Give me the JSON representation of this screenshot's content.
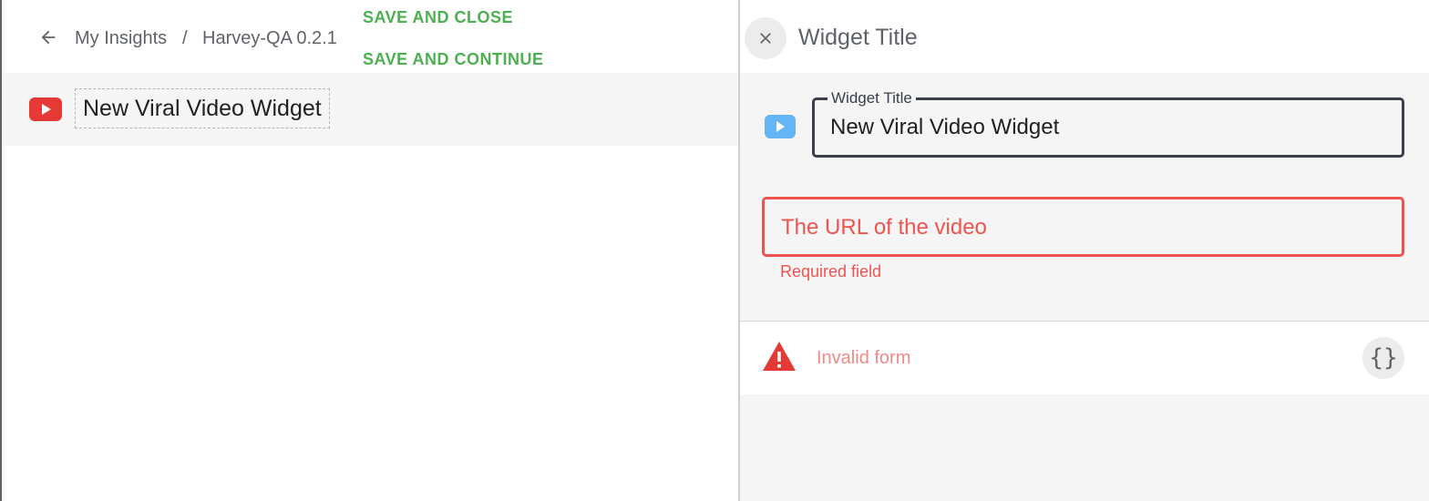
{
  "header": {
    "breadcrumb": [
      "My Insights",
      "Harvey-QA 0.2.1"
    ],
    "breadcrumb_separator": "/",
    "save_close_label": "SAVE AND CLOSE",
    "save_continue_label": "SAVE AND CONTINUE",
    "back_icon": "arrow-back-icon"
  },
  "widget_row": {
    "icon": "youtube-icon",
    "title": "New Viral Video Widget"
  },
  "panel": {
    "title": "Widget Title",
    "close_icon": "close-icon",
    "title_field": {
      "label": "Widget Title",
      "value": "New Viral Video Widget",
      "icon": "video-play-icon"
    },
    "url_field": {
      "placeholder": "The URL of the video",
      "value": "",
      "error": "Required field"
    },
    "status": {
      "icon": "warning-icon",
      "text": "Invalid form",
      "json_button_label": "{}"
    }
  },
  "colors": {
    "accent_green": "#4caf50",
    "error_red": "#ef5350",
    "youtube_red": "#e53935",
    "video_blue": "#64b5f6"
  }
}
